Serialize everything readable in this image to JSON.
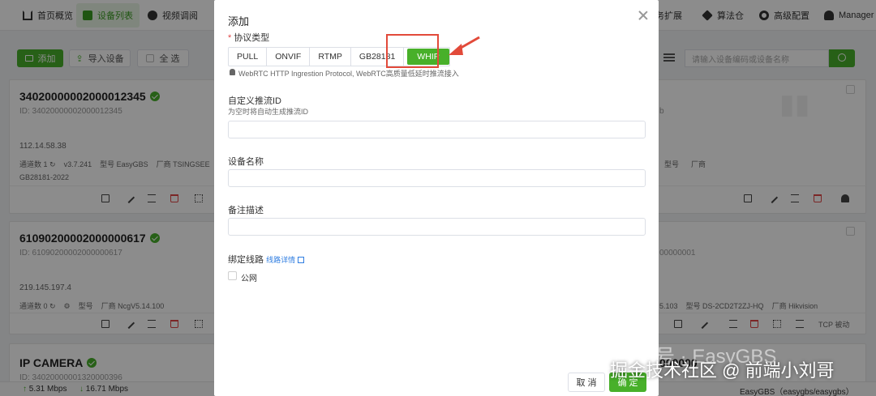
{
  "nav": {
    "items": [
      {
        "label": "首页概览",
        "icon": "home-icon"
      },
      {
        "label": "设备列表",
        "icon": "camera-icon",
        "active": true
      },
      {
        "label": "视频调阅",
        "icon": "play-circle-icon"
      }
    ],
    "right_items": [
      {
        "label": "务扩展",
        "icon": "puzzle-icon"
      },
      {
        "label": "算法仓",
        "icon": "dropbox-icon"
      },
      {
        "label": "高级配置",
        "icon": "gear-icon"
      },
      {
        "label": "Manager",
        "icon": "user-icon"
      }
    ]
  },
  "toolbar": {
    "add_label": "添加",
    "import_label": "导入设备",
    "select_all_label": "全 选",
    "search_placeholder": "请输入设备编码或设备名称"
  },
  "cards": [
    {
      "title": "34020000002000012345",
      "sub": "ID: 34020000002000012345",
      "ip": "112.14.58.38",
      "meta": [
        "通道数 1",
        "v3.7.241",
        "型号 EasyGBS",
        "厂商 TSINGSEE"
      ],
      "protocol": "GB28181-2022"
    },
    {
      "title": "61090200002000000617",
      "sub": "ID: 61090200002000000617",
      "ip": "219.145.197.4",
      "meta": [
        "通道数 0",
        "型号",
        "厂商 NcgV5.14.100"
      ]
    },
    {
      "title": "IP CAMERA",
      "sub": "ID: 34020000001320000396"
    }
  ],
  "right_cards": [
    {
      "frag": "b",
      "meta": [
        "型号",
        "厂商"
      ]
    },
    {
      "frag": "00000001",
      "meta": [
        "5.103",
        "型号 DS-2CD2T2ZJ-HQ",
        "厂商 Hikvision"
      ],
      "mode": "TCP 被动"
    },
    {
      "frag": "000000"
    }
  ],
  "modal": {
    "title": "添加",
    "protocol_label": "协议类型",
    "protocols": [
      "PULL",
      "ONVIF",
      "RTMP",
      "GB28181",
      "WHIP"
    ],
    "active_protocol": "WHIP",
    "protocol_hint": "WebRTC HTTP Ingrestion Protocol, WebRTC高质量低延时推流接入",
    "stream_id_label": "自定义推流ID",
    "stream_id_hint": "为空时将自动生成推流ID",
    "stream_id_value": "",
    "device_name_label": "设备名称",
    "device_name_value": "",
    "remark_label": "备注描述",
    "remark_value": "",
    "bind_line_label": "绑定线路",
    "bind_line_link": "线路详情",
    "public_net_label": "公网",
    "cancel_label": "取 消",
    "ok_label": "确 定"
  },
  "statusbar": {
    "upload": "5.31 Mbps",
    "download": "16.71 Mbps",
    "version": "EasyGBS（easygbs/easygbs）"
  },
  "watermark": {
    "line1": "公众号 · EasyGBS",
    "line2": "掘金技术社区 @ 前端小刘哥"
  },
  "colors": {
    "accent": "#48b02a",
    "highlight": "#e24a3a",
    "link": "#2f7de1",
    "danger": "#e04646"
  }
}
